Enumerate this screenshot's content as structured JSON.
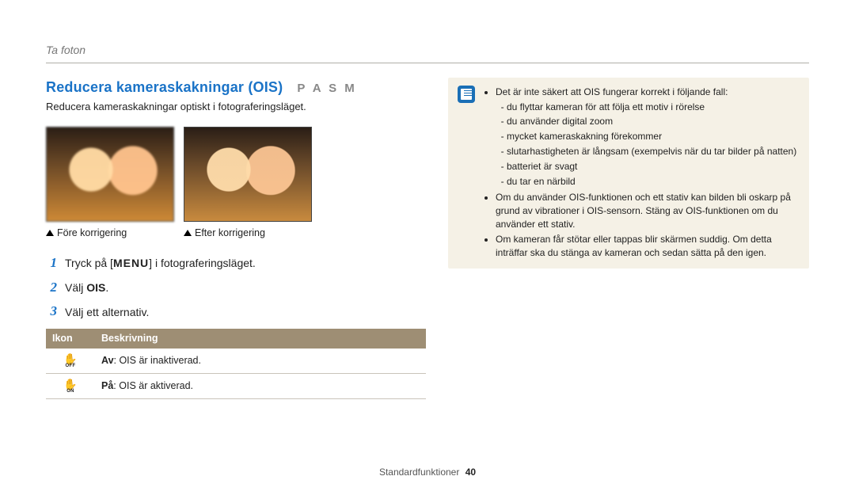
{
  "breadcrumb": "Ta foton",
  "heading": "Reducera kameraskakningar (OIS)",
  "modes": "P A S M",
  "lead": "Reducera kameraskakningar optiskt i fotograferingsläget.",
  "captions": {
    "before": "Före korrigering",
    "after": "Efter korrigering"
  },
  "steps": {
    "s1_a": "Tryck på [",
    "s1_menu": "MENU",
    "s1_b": "] i fotograferingsläget.",
    "s2_a": "Välj ",
    "s2_b": "OIS",
    "s2_c": ".",
    "s3": "Välj ett alternativ."
  },
  "table": {
    "th_icon": "Ikon",
    "th_desc": "Beskrivning",
    "rows": [
      {
        "iconSub": "OFF",
        "strong": "Av",
        "rest": ": OIS är inaktiverad."
      },
      {
        "iconSub": "ON",
        "strong": "På",
        "rest": ": OIS är aktiverad."
      }
    ]
  },
  "note": {
    "intro": "Det är inte säkert att OIS fungerar korrekt i följande fall:",
    "sub": [
      "du flyttar kameran för att följa ett motiv i rörelse",
      "du använder digital zoom",
      "mycket kameraskakning förekommer",
      "slutarhastigheten är långsam (exempelvis när du tar bilder på natten)",
      "batteriet är svagt",
      "du tar en närbild"
    ],
    "b2": "Om du använder OIS-funktionen och ett stativ kan bilden bli oskarp på grund av vibrationer i OIS-sensorn. Stäng av OIS-funktionen om du använder ett stativ.",
    "b3": "Om kameran får stötar eller tappas blir skärmen suddig. Om detta inträffar ska du stänga av kameran och sedan sätta på den igen."
  },
  "footer": {
    "section": "Standardfunktioner",
    "page": "40"
  }
}
